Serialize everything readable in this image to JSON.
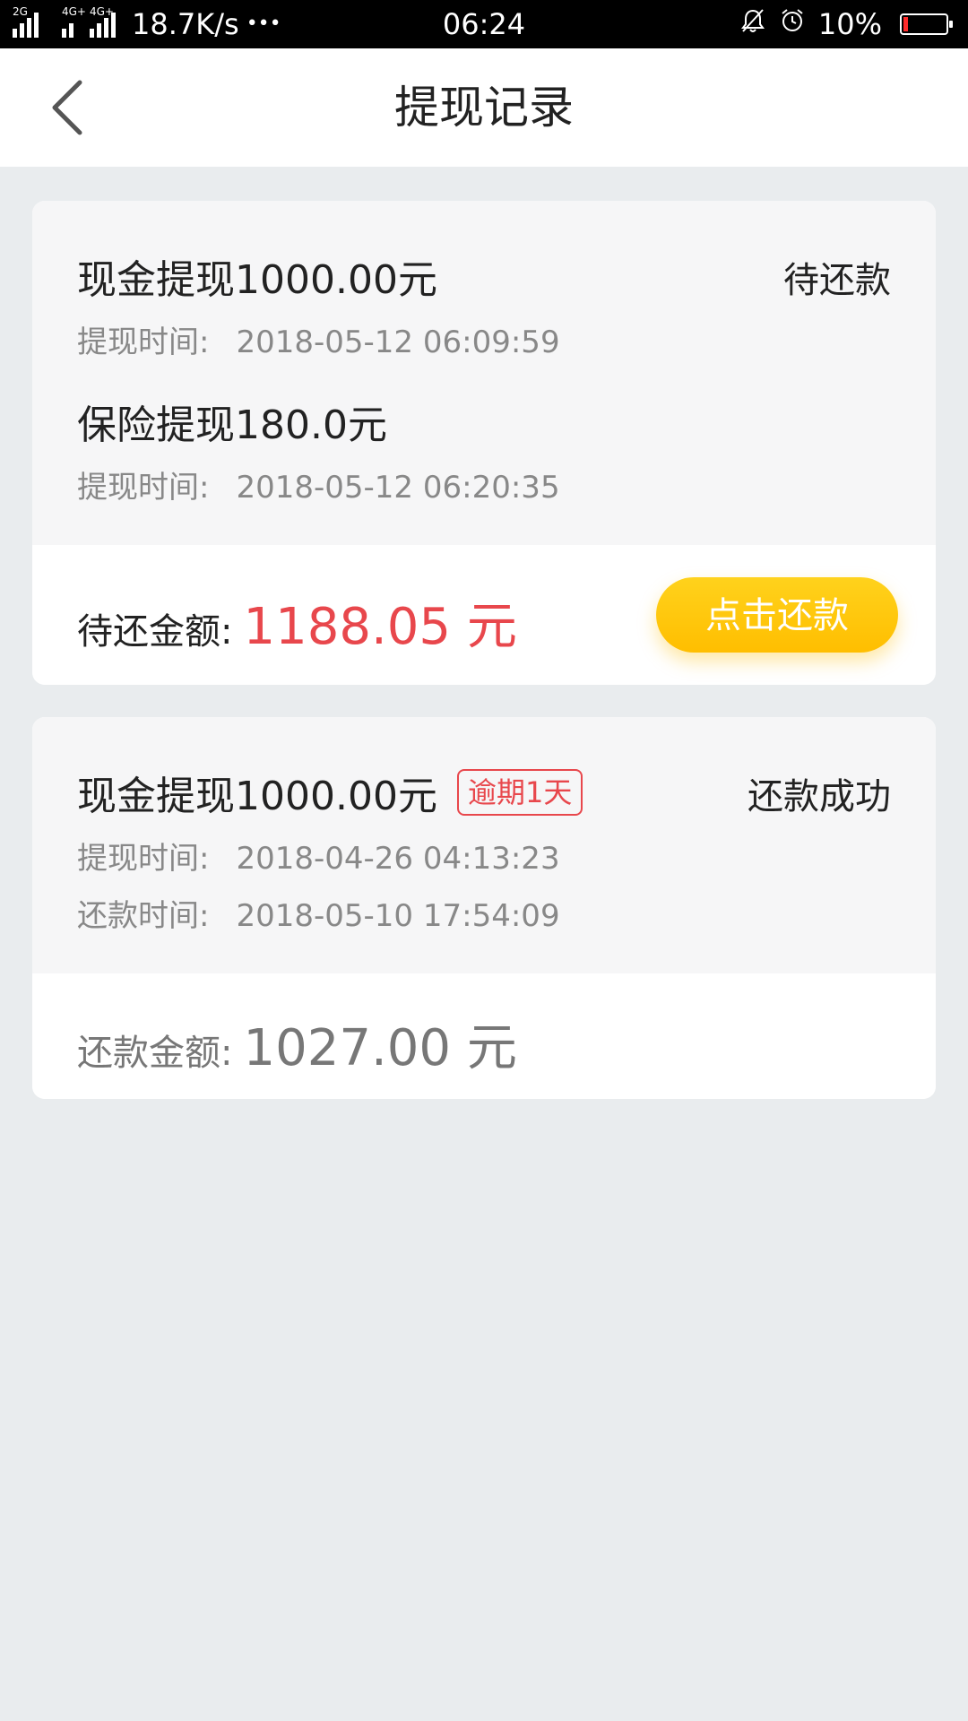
{
  "status_bar": {
    "network_left": "2G",
    "network_right_1": "4G+",
    "network_right_2": "4G+",
    "speed": "18.7K/s",
    "more": "•••",
    "time": "06:24",
    "battery": "10%",
    "battery_level": 0.1,
    "icons": [
      "mute-bell-icon",
      "alarm-icon",
      "battery-icon"
    ]
  },
  "nav": {
    "title": "提现记录",
    "back_icon": "chevron-left-icon"
  },
  "records": [
    {
      "status": "待还款",
      "items": [
        {
          "title": "现金提现1000.00元",
          "time_label": "提现时间:",
          "time": "2018-05-12 06:09:59"
        },
        {
          "title": "保险提现180.0元",
          "time_label": "提现时间:",
          "time": "2018-05-12 06:20:35"
        }
      ],
      "amount_label": "待还金额:",
      "amount_value": "1188.05 元",
      "amount_color": "#e8474c",
      "button_label": "点击还款"
    },
    {
      "status": "还款成功",
      "title": "现金提现1000.00元",
      "badge": "逾期1天",
      "withdraw_label": "提现时间:",
      "withdraw_time": "2018-04-26 04:13:23",
      "repay_label": "还款时间:",
      "repay_time": "2018-05-10 17:54:09",
      "amount_label": "还款金额:",
      "amount_value": "1027.00 元",
      "amount_color": "#777777"
    }
  ]
}
